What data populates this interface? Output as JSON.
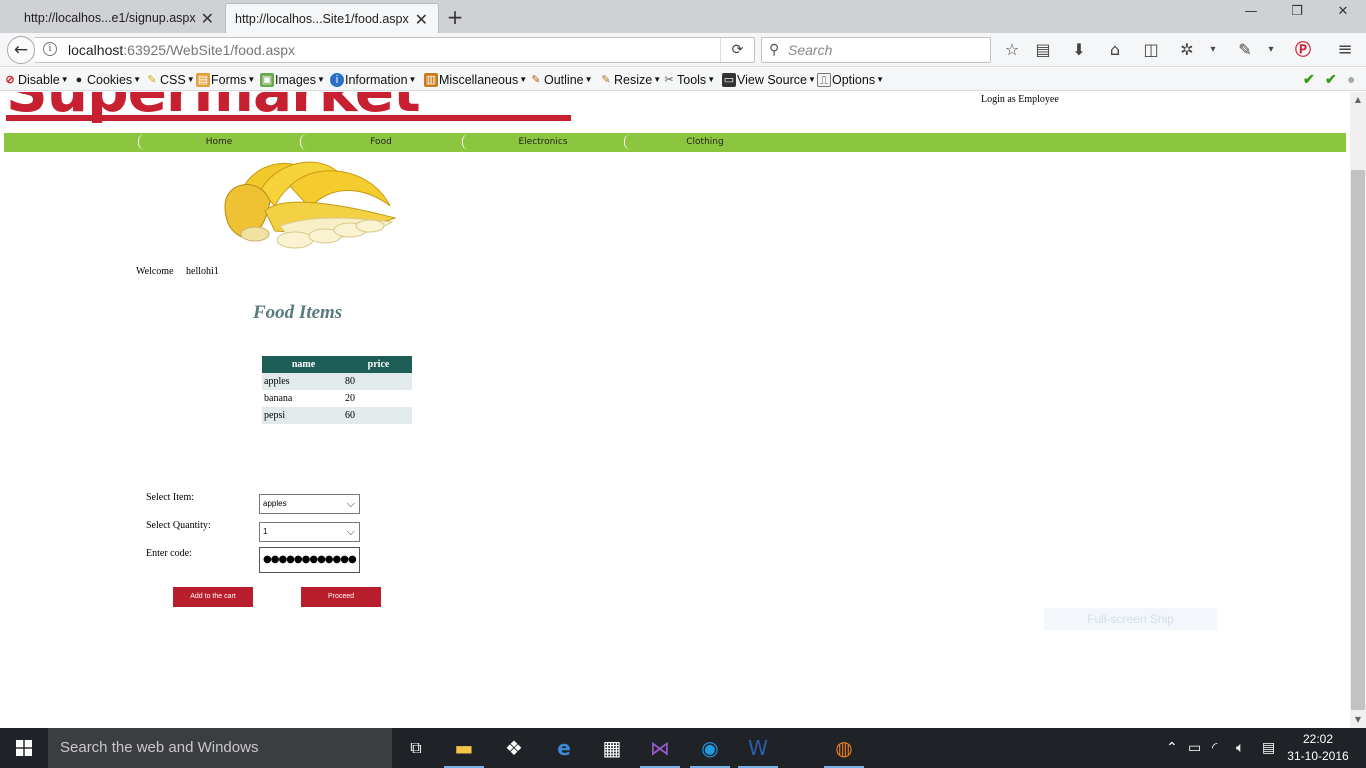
{
  "browser": {
    "tabs": [
      {
        "title": "http://localhos...e1/signup.aspx",
        "active": false
      },
      {
        "title": "http://localhos...Site1/food.aspx",
        "active": true
      }
    ],
    "url_host": "localhost",
    "url_rest": ":63925/WebSite1/food.aspx",
    "search_placeholder": "Search"
  },
  "devbar": {
    "items": [
      {
        "label": "Disable",
        "icon": "disable-icon"
      },
      {
        "label": "Cookies",
        "icon": "cookies-icon"
      },
      {
        "label": "CSS",
        "icon": "css-icon"
      },
      {
        "label": "Forms",
        "icon": "forms-icon"
      },
      {
        "label": "Images",
        "icon": "images-icon"
      },
      {
        "label": "Information",
        "icon": "information-icon"
      },
      {
        "label": "Miscellaneous",
        "icon": "miscellaneous-icon"
      },
      {
        "label": "Outline",
        "icon": "outline-icon"
      },
      {
        "label": "Resize",
        "icon": "resize-icon"
      },
      {
        "label": "Tools",
        "icon": "tools-icon"
      },
      {
        "label": "View Source",
        "icon": "view-source-icon"
      },
      {
        "label": "Options",
        "icon": "options-icon"
      }
    ]
  },
  "site": {
    "logo_text": "Supermarket",
    "login_link": "Login as Employee",
    "menu": [
      "Home",
      "Food",
      "Electronics",
      "Clothing"
    ],
    "welcome_label": "Welcome",
    "username": "hellohi1",
    "page_title": "Food Items",
    "grid": {
      "headers": [
        "name",
        "price"
      ],
      "rows": [
        {
          "name": "apples",
          "price": "80"
        },
        {
          "name": "banana",
          "price": "20"
        },
        {
          "name": "pepsi",
          "price": "60"
        }
      ]
    },
    "form": {
      "select_item_label": "Select Item:",
      "select_item_value": "apples",
      "select_quantity_label": "Select Quantity:",
      "select_quantity_value": "1",
      "enter_code_label": "Enter code:",
      "code_value": "●●●●●●●●●●●●"
    },
    "add_to_cart_label": "Add to the cart",
    "proceed_label": "Proceed",
    "snip_label": "Full-screen Snip"
  },
  "taskbar": {
    "search_placeholder": "Search the web and Windows",
    "time": "22:02",
    "date": "31-10-2016"
  },
  "colors": {
    "menu_green": "#8cc63e",
    "grid_header": "#1c5e55",
    "button_red": "#b81e2b",
    "logo_red": "#c62031"
  }
}
